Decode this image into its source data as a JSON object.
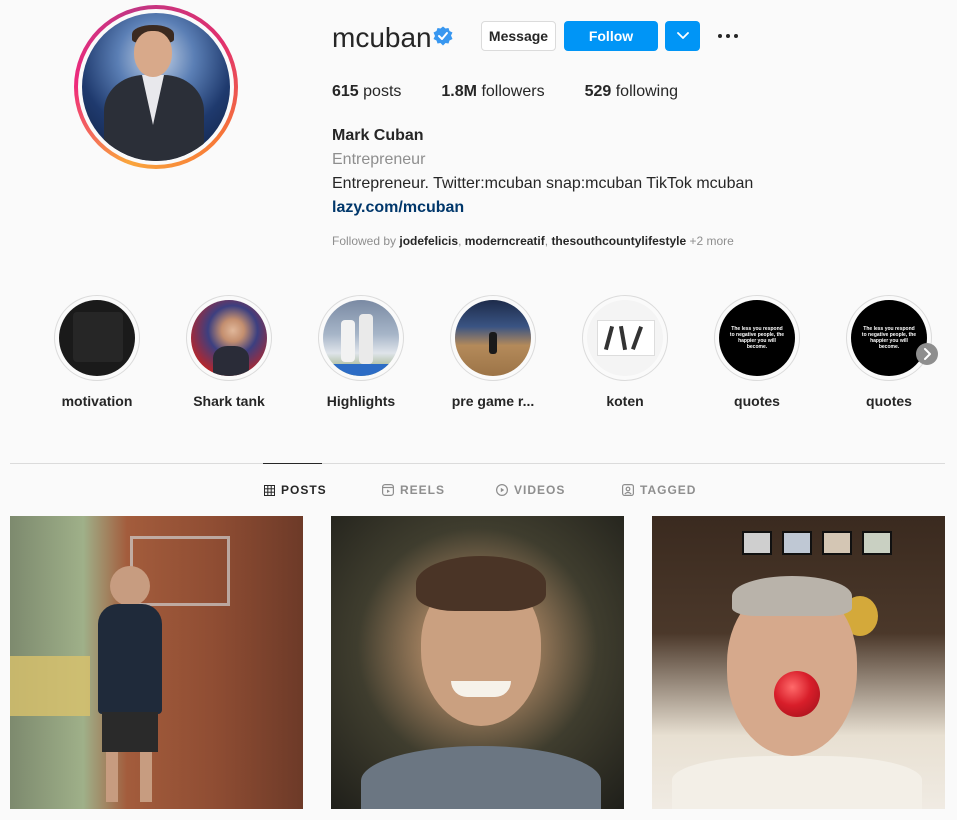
{
  "profile": {
    "username": "mcuban",
    "verified": true,
    "full_name": "Mark Cuban",
    "category": "Entrepreneur",
    "bio": "Entrepreneur. Twitter:mcuban snap:mcuban TikTok mcuban",
    "link": "lazy.com/mcuban"
  },
  "actions": {
    "message_label": "Message",
    "follow_label": "Follow"
  },
  "stats": {
    "posts_count": "615",
    "posts_label": "posts",
    "followers_count": "1.8M",
    "followers_label": "followers",
    "following_count": "529",
    "following_label": "following"
  },
  "followed_by": {
    "prefix": "Followed by",
    "users": [
      "jodefelicis",
      "moderncreatif",
      "thesouthcountylifestyle"
    ],
    "more": "+2 more"
  },
  "highlights": [
    {
      "label": "motivation"
    },
    {
      "label": "Shark tank"
    },
    {
      "label": "Highlights"
    },
    {
      "label": "pre game r..."
    },
    {
      "label": "koten"
    },
    {
      "label": "quotes"
    },
    {
      "label": "quotes"
    }
  ],
  "quote_text": "The less you respond to negative people, the happier you will become.",
  "tabs": [
    {
      "label": "POSTS",
      "icon": "grid-icon",
      "active": true
    },
    {
      "label": "REELS",
      "icon": "reels-icon",
      "active": false
    },
    {
      "label": "VIDEOS",
      "icon": "play-icon",
      "active": false
    },
    {
      "label": "TAGGED",
      "icon": "tagged-icon",
      "active": false
    }
  ],
  "colors": {
    "accent": "#0095f6",
    "link": "#00376b",
    "muted": "#8e8e8e"
  }
}
